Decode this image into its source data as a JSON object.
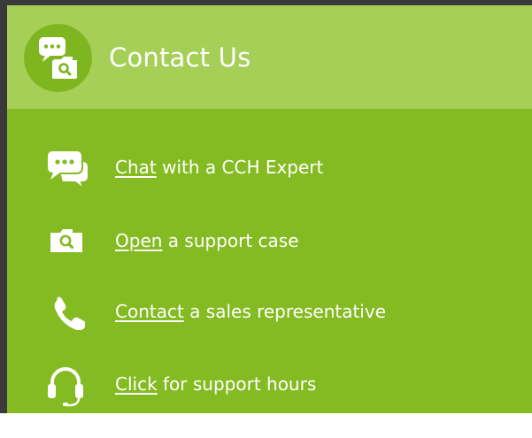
{
  "panel": {
    "title": "Contact Us",
    "header_icon": "chat-search-icon",
    "colors": {
      "header_bg": "#a6cf57",
      "body_bg": "#85bb22",
      "icon_circle": "#7fb61f",
      "text": "#ffffff"
    }
  },
  "items": [
    {
      "icon": "chat-bubbles-icon",
      "link_text": "Chat",
      "rest_text": " with a CCH Expert"
    },
    {
      "icon": "search-case-icon",
      "link_text": "Open",
      "rest_text": " a support case"
    },
    {
      "icon": "phone-icon",
      "link_text": "Contact",
      "rest_text": " a sales representative"
    },
    {
      "icon": "headset-icon",
      "link_text": "Click",
      "rest_text": " for support hours"
    }
  ]
}
